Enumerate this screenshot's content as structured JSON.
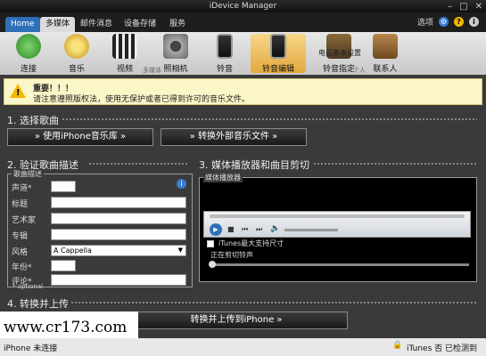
{
  "window": {
    "title": "iDevice Manager"
  },
  "tabs": {
    "home": "Home",
    "multimedia": "多媒体",
    "mail": "邮件消息",
    "storage": "设备存储",
    "services": "服务"
  },
  "topright": {
    "options": "选项"
  },
  "ribbon": {
    "buttons": [
      "连接",
      "音乐",
      "视频",
      "照相机",
      "铃音",
      "铃音编辑",
      "铃音指定",
      "联系人"
    ],
    "overlay_text": "电话基本设置",
    "group_label": "多媒体",
    "group_label_right": "个人"
  },
  "warning": {
    "title": "重要！！！",
    "text": "请注意遵照版权法，使用无保护或者已得到许可的音乐文件。"
  },
  "section1": {
    "title": "1. 选择歌曲",
    "btn_library": "» 使用iPhone音乐库 »",
    "btn_convert": "» 转换外部音乐文件 »"
  },
  "section2": {
    "title": "2. 验证歌曲描述",
    "panel_title": "歌曲描述",
    "fields": {
      "track": "声道*",
      "title": "标题",
      "artist": "艺术家",
      "album": "专辑",
      "genre": "风格",
      "year": "年份*",
      "comment": "评论*"
    },
    "genre_value": "A Cappella",
    "optional_note": "* optional"
  },
  "section3": {
    "title": "3. 媒体播放器和曲目剪切",
    "panel_title": "媒体播放器",
    "maxsize_label": "iTunes最大支持尺寸",
    "cutting_label": "正在剪切铃声"
  },
  "section4": {
    "title": "4. 转换并上传",
    "btn_upload": "转换并上传到iPhone »"
  },
  "watermark": "www.cr173.com",
  "status": {
    "left": "iPhone 未连接",
    "right": "iTunes 否 已检测到"
  }
}
